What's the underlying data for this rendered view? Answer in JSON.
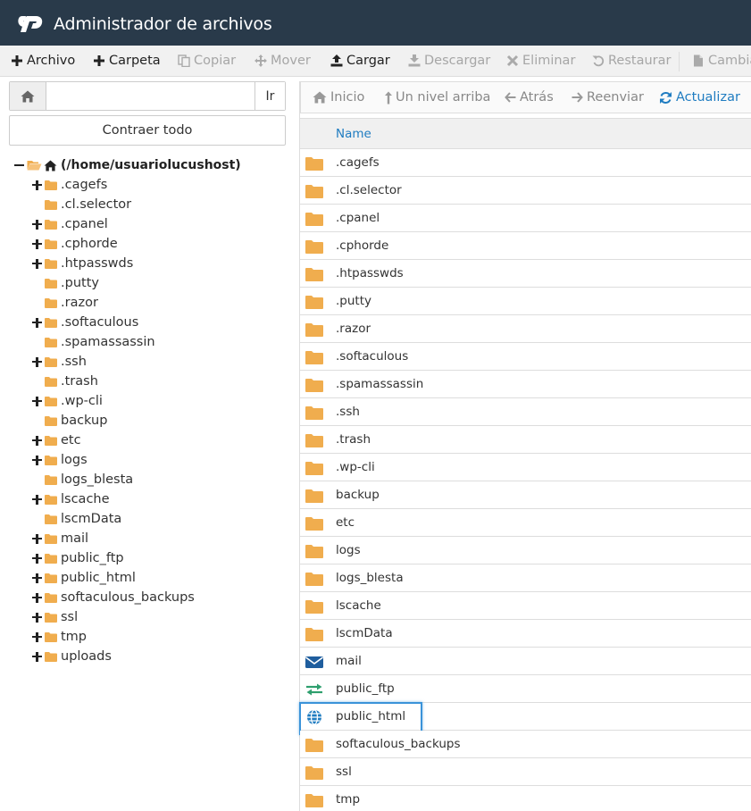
{
  "app": {
    "title": "Administrador de archivos",
    "brand_color": "#293a4a",
    "accent_color": "#1f7cc1",
    "folder_color": "#f0ad4e"
  },
  "toolbar": {
    "buttons": [
      {
        "label": "Archivo",
        "icon": "plus-icon",
        "enabled": true
      },
      {
        "label": "Carpeta",
        "icon": "plus-icon",
        "enabled": true
      },
      {
        "label": "Copiar",
        "icon": "copy-icon",
        "enabled": false
      },
      {
        "label": "Mover",
        "icon": "move-icon",
        "enabled": false
      },
      {
        "label": "Cargar",
        "icon": "upload-icon",
        "enabled": true
      },
      {
        "label": "Descargar",
        "icon": "download-icon",
        "enabled": false
      },
      {
        "label": "Eliminar",
        "icon": "times-icon",
        "enabled": false
      },
      {
        "label": "Restaurar",
        "icon": "undo-icon",
        "enabled": false
      },
      {
        "label": "Cambia",
        "icon": "file-icon",
        "enabled": false
      }
    ]
  },
  "path_bar": {
    "value": "",
    "go_label": "Ir"
  },
  "collapse_all_label": "Contraer todo",
  "tree": {
    "root_label": "(/home/usuariolucushost)",
    "items": [
      {
        "label": ".cagefs",
        "expandable": true
      },
      {
        "label": ".cl.selector",
        "expandable": false
      },
      {
        "label": ".cpanel",
        "expandable": true
      },
      {
        "label": ".cphorde",
        "expandable": true
      },
      {
        "label": ".htpasswds",
        "expandable": true
      },
      {
        "label": ".putty",
        "expandable": false
      },
      {
        "label": ".razor",
        "expandable": false
      },
      {
        "label": ".softaculous",
        "expandable": true
      },
      {
        "label": ".spamassassin",
        "expandable": false
      },
      {
        "label": ".ssh",
        "expandable": true
      },
      {
        "label": ".trash",
        "expandable": false
      },
      {
        "label": ".wp-cli",
        "expandable": true
      },
      {
        "label": "backup",
        "expandable": false
      },
      {
        "label": "etc",
        "expandable": true
      },
      {
        "label": "logs",
        "expandable": true
      },
      {
        "label": "logs_blesta",
        "expandable": false
      },
      {
        "label": "lscache",
        "expandable": true
      },
      {
        "label": "lscmData",
        "expandable": false
      },
      {
        "label": "mail",
        "expandable": true
      },
      {
        "label": "public_ftp",
        "expandable": true
      },
      {
        "label": "public_html",
        "expandable": true
      },
      {
        "label": "softaculous_backups",
        "expandable": true
      },
      {
        "label": "ssl",
        "expandable": true
      },
      {
        "label": "tmp",
        "expandable": true
      },
      {
        "label": "uploads",
        "expandable": true
      }
    ]
  },
  "nav": {
    "buttons": [
      {
        "label": "Inicio",
        "icon": "home-icon",
        "active": false
      },
      {
        "label": "Un nivel arriba",
        "icon": "level-up-icon",
        "active": false
      },
      {
        "label": "Atrás",
        "icon": "arrow-left-icon",
        "active": false
      },
      {
        "label": "Reenviar",
        "icon": "arrow-right-icon",
        "active": false
      },
      {
        "label": "Actualizar",
        "icon": "refresh-icon",
        "active": true
      }
    ]
  },
  "file_table": {
    "column_name": "Name",
    "rows": [
      {
        "name": ".cagefs",
        "type": "folder"
      },
      {
        "name": ".cl.selector",
        "type": "folder"
      },
      {
        "name": ".cpanel",
        "type": "folder"
      },
      {
        "name": ".cphorde",
        "type": "folder"
      },
      {
        "name": ".htpasswds",
        "type": "folder"
      },
      {
        "name": ".putty",
        "type": "folder"
      },
      {
        "name": ".razor",
        "type": "folder"
      },
      {
        "name": ".softaculous",
        "type": "folder"
      },
      {
        "name": ".spamassassin",
        "type": "folder"
      },
      {
        "name": ".ssh",
        "type": "folder"
      },
      {
        "name": ".trash",
        "type": "folder"
      },
      {
        "name": ".wp-cli",
        "type": "folder"
      },
      {
        "name": "backup",
        "type": "folder"
      },
      {
        "name": "etc",
        "type": "folder"
      },
      {
        "name": "logs",
        "type": "folder"
      },
      {
        "name": "logs_blesta",
        "type": "folder"
      },
      {
        "name": "lscache",
        "type": "folder"
      },
      {
        "name": "lscmData",
        "type": "folder"
      },
      {
        "name": "mail",
        "type": "mail"
      },
      {
        "name": "public_ftp",
        "type": "ftp"
      },
      {
        "name": "public_html",
        "type": "web",
        "highlighted": true
      },
      {
        "name": "softaculous_backups",
        "type": "folder"
      },
      {
        "name": "ssl",
        "type": "folder"
      },
      {
        "name": "tmp",
        "type": "folder"
      }
    ]
  }
}
